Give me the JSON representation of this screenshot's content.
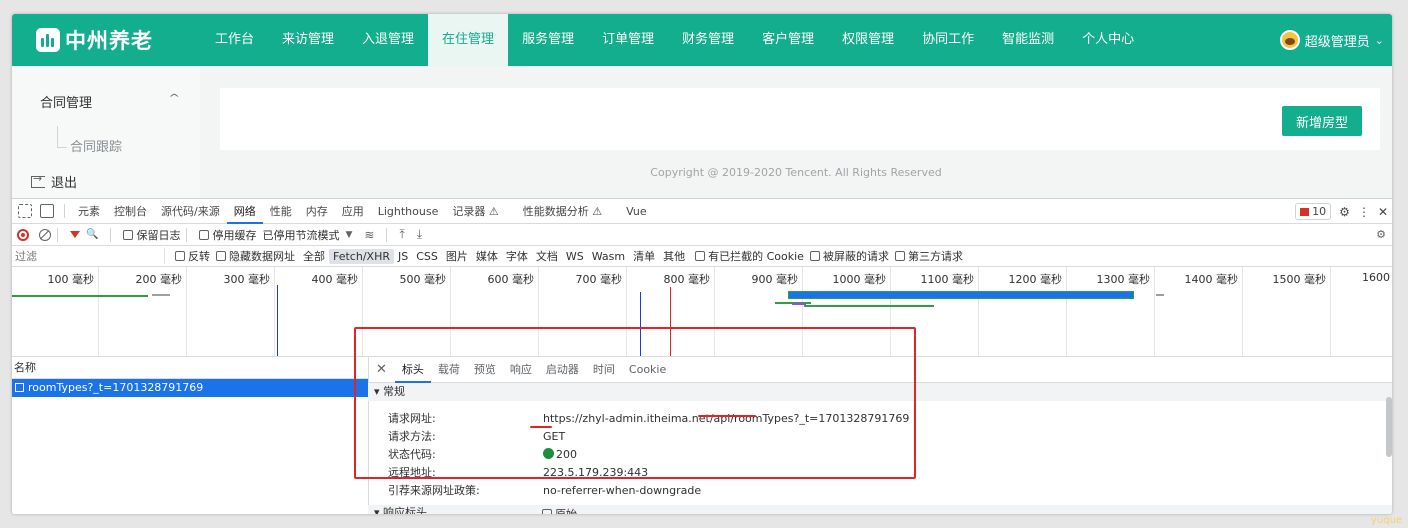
{
  "app": {
    "logo_text": "中州养老",
    "nav": [
      {
        "label": "工作台"
      },
      {
        "label": "来访管理"
      },
      {
        "label": "入退管理"
      },
      {
        "label": "在住管理",
        "active": true
      },
      {
        "label": "服务管理"
      },
      {
        "label": "订单管理"
      },
      {
        "label": "财务管理"
      },
      {
        "label": "客户管理"
      },
      {
        "label": "权限管理"
      },
      {
        "label": "协同工作"
      },
      {
        "label": "智能监测"
      },
      {
        "label": "个人中心"
      }
    ],
    "user_name": "超级管理员",
    "user_caret": "⌄",
    "accent": "#13ae8e"
  },
  "sidebar": {
    "group_label": "合同管理",
    "group_chevron": "^",
    "sub_label": "合同跟踪",
    "logout_label": "退出"
  },
  "main": {
    "add_button": "新增房型",
    "copyright": "Copyright @ 2019-2020 Tencent. All Rights Reserved"
  },
  "devtools": {
    "tabs": [
      "元素",
      "控制台",
      "源代码/来源",
      "网络",
      "性能",
      "内存",
      "应用",
      "Lighthouse",
      "记录器 ⚠",
      "性能数据分析 ⚠",
      "Vue"
    ],
    "active_tab": "网络",
    "issues_count": "10",
    "toolbar": {
      "preserve_log": "保留日志",
      "disable_cache": "停用缓存",
      "throttle": "已停用节流模式",
      "throttle_caret": "▼",
      "wifi_glyph": "≋",
      "upload_glyph": "⤒",
      "download_glyph": "⤓",
      "search_glyph": "🔍"
    },
    "filter": {
      "placeholder": "过滤",
      "invert": "反转",
      "hide_data_urls": "隐藏数据网址",
      "types": [
        "全部",
        "Fetch/XHR",
        "JS",
        "CSS",
        "图片",
        "媒体",
        "字体",
        "文档",
        "WS",
        "Wasm",
        "清单",
        "其他"
      ],
      "active_type": "Fetch/XHR",
      "blocked_cookies": "有已拦截的 Cookie",
      "blocked_requests": "被屏蔽的请求",
      "third_party": "第三方请求"
    },
    "timeline_labels": [
      "100 毫秒",
      "200 毫秒",
      "300 毫秒",
      "400 毫秒",
      "500 毫秒",
      "600 毫秒",
      "700 毫秒",
      "800 毫秒",
      "900 毫秒",
      "1000 毫秒",
      "1100 毫秒",
      "1200 毫秒",
      "1300 毫秒",
      "1400 毫秒",
      "1500 毫秒",
      "1600"
    ],
    "list": {
      "header": "名称",
      "rows": [
        {
          "name": "roomTypes?_t=1701328791769"
        }
      ]
    },
    "detail": {
      "close_glyph": "✕",
      "tabs": [
        "标头",
        "载荷",
        "预览",
        "响应",
        "启动器",
        "时间",
        "Cookie"
      ],
      "active_tab": "标头",
      "general_header": "▾ 常规",
      "fields": [
        {
          "key": "请求网址:",
          "value": "https://zhyl-admin.itheima.net/api/roomTypes?_t=1701328791769"
        },
        {
          "key": "请求方法:",
          "value": "GET"
        },
        {
          "key": "状态代码:",
          "value": "200"
        },
        {
          "key": "远程地址:",
          "value": "223.5.179.239:443"
        },
        {
          "key": "引荐来源网址政策:",
          "value": "no-referrer-when-downgrade"
        }
      ],
      "response_header": "▾ 响应标头",
      "raw_label": "原始"
    }
  },
  "watermark": "yuque"
}
